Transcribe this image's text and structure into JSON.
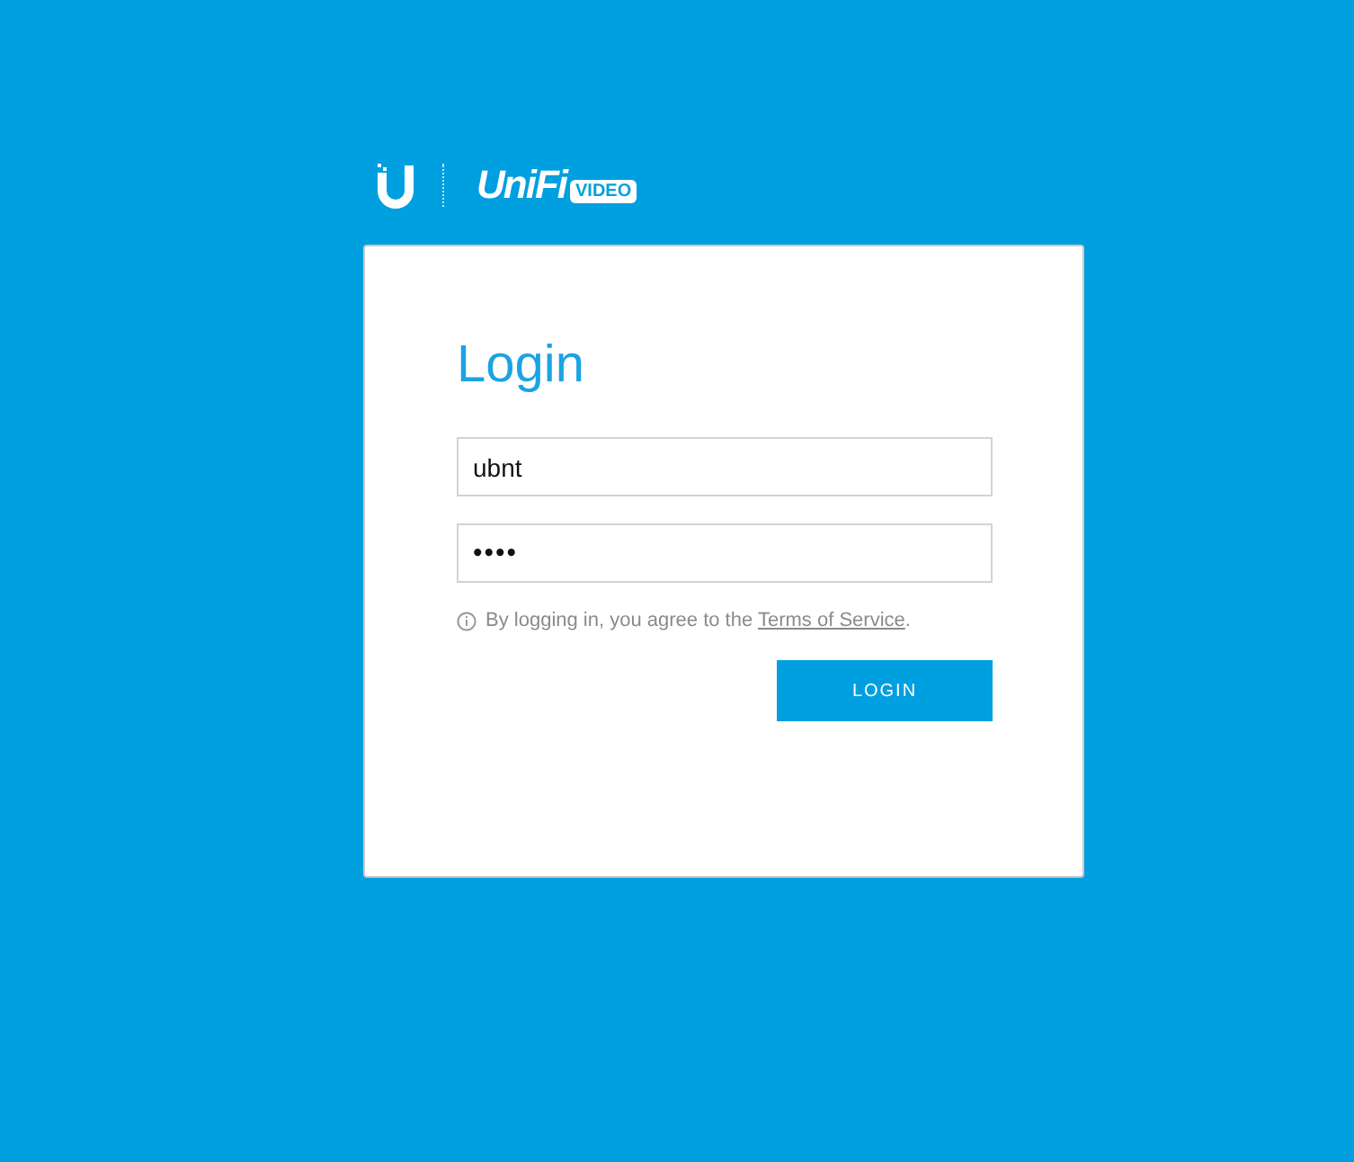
{
  "logo": {
    "brand": "UniFi",
    "badge": "VIDEO"
  },
  "login": {
    "title": "Login",
    "fields": [
      {
        "kind": "text",
        "value": "ubnt"
      },
      {
        "kind": "password",
        "value": "••••"
      }
    ],
    "notice": {
      "before": "By logging in, you agree to the ",
      "link": "Terms of Service",
      "after": "."
    },
    "button": "LOGIN"
  }
}
